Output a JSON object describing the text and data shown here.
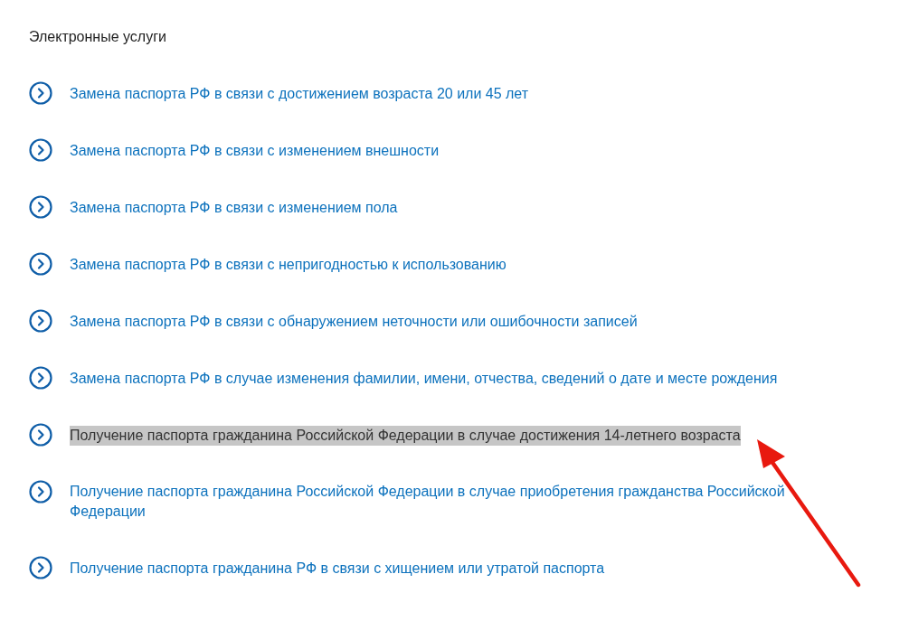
{
  "heading": "Электронные услуги",
  "services": [
    {
      "label": "Замена паспорта РФ в связи с достижением возраста 20 или 45 лет",
      "selected": false
    },
    {
      "label": "Замена паспорта РФ в связи с изменением внешности",
      "selected": false
    },
    {
      "label": "Замена паспорта РФ в связи с изменением пола",
      "selected": false
    },
    {
      "label": "Замена паспорта РФ в связи с непригодностью к использованию",
      "selected": false
    },
    {
      "label": "Замена паспорта РФ в связи с обнаружением неточности или ошибочности записей",
      "selected": false
    },
    {
      "label": "Замена паспорта РФ в случае изменения фамилии, имени, отчества, сведений о дате и месте рождения",
      "selected": false
    },
    {
      "label": "Получение паспорта гражданина Российской Федерации в случае достижения 14-летнего возраста",
      "selected": true
    },
    {
      "label": "Получение паспорта гражданина Российской Федерации в случае приобретения гражданства Российской Федерации",
      "selected": false
    },
    {
      "label": "Получение паспорта гражданина РФ в связи с хищением или утратой паспорта",
      "selected": false
    }
  ]
}
